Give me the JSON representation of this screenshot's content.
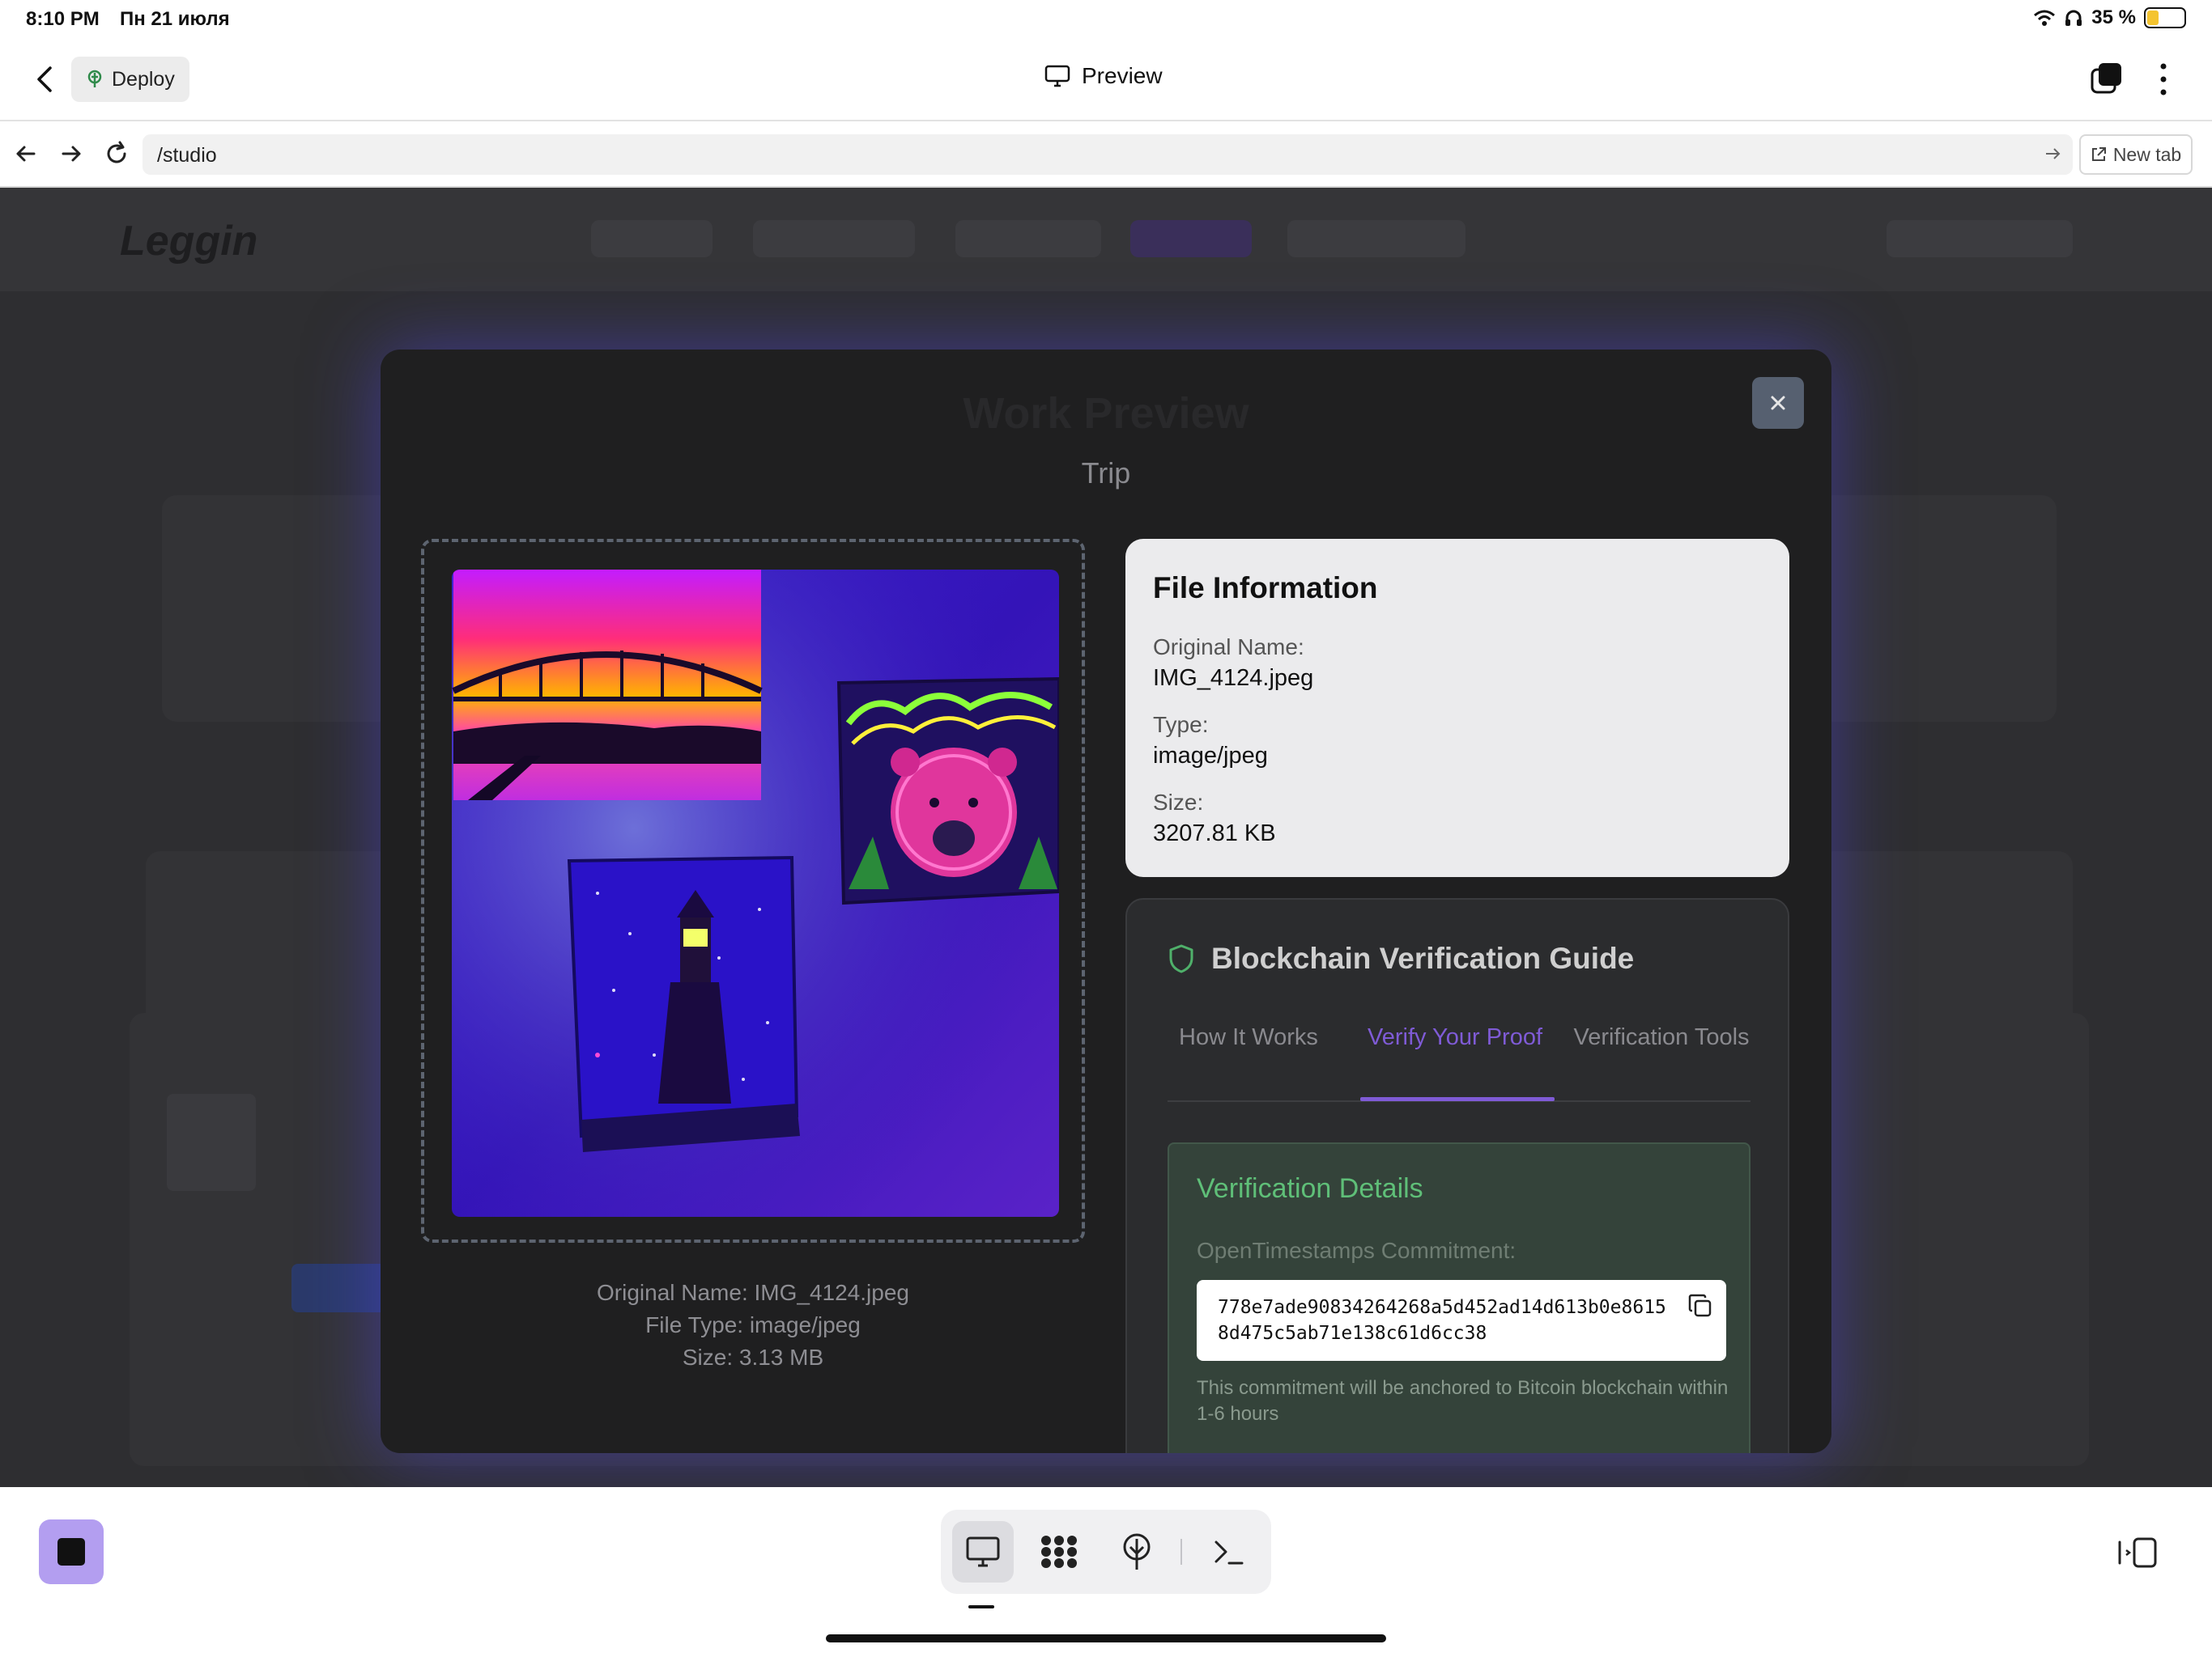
{
  "status_bar": {
    "time": "8:10 PM",
    "date": "Пн 21 июля",
    "battery": "35 %"
  },
  "app_bar": {
    "deploy_label": "Deploy",
    "title": "Preview"
  },
  "url_bar": {
    "url": "/studio",
    "new_tab_label": "New tab"
  },
  "modal": {
    "ghost_title": "Work Preview",
    "subtitle": "Trip",
    "preview_caption": {
      "name": "Original Name: IMG_4124.jpeg",
      "type": "File Type: image/jpeg",
      "size": "Size: 3.13 MB"
    },
    "file_info": {
      "heading": "File Information",
      "name_label": "Original Name:",
      "name_value": "IMG_4124.jpeg",
      "type_label": "Type:",
      "type_value": "image/jpeg",
      "size_label": "Size:",
      "size_value": "3207.81 KB"
    },
    "guide": {
      "heading": "Blockchain Verification Guide",
      "tabs": [
        {
          "label": "How It Works"
        },
        {
          "label": "Verify Your Proof",
          "active": true
        },
        {
          "label": "Verification Tools"
        }
      ],
      "details_title": "Verification Details",
      "commitment_label": "OpenTimestamps Commitment:",
      "commitment_hash": "778e7ade90834264268a5d452ad14d613b0e86158d475c5ab71e138c61d6cc38",
      "note": "This commitment will be anchored to Bitcoin blockchain within 1-6 hours"
    }
  },
  "colors": {
    "accent_purple": "#7f5bd6",
    "verify_green": "#5fbf78",
    "stop_button": "#b39ef0"
  },
  "icons": [
    "back-icon",
    "deploy-icon",
    "monitor-icon",
    "tabs-icon",
    "kebab-icon",
    "arrow-left-icon",
    "arrow-right-icon",
    "reload-icon",
    "go-icon",
    "external-link-icon",
    "close-icon",
    "shield-icon",
    "copy-icon",
    "stop-icon",
    "grid-icon",
    "tree-icon",
    "terminal-icon",
    "sidebar-toggle-icon"
  ]
}
